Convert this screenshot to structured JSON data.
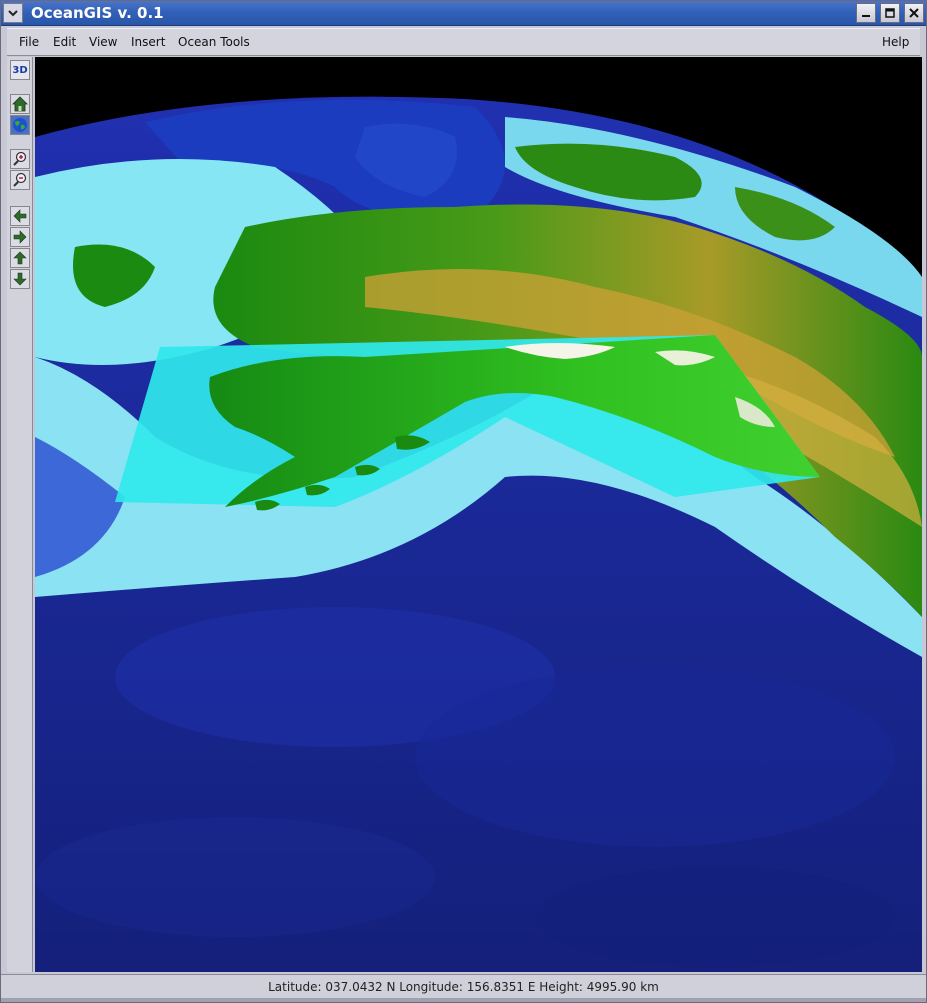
{
  "window": {
    "title": "OceanGIS v. 0.1",
    "menu_button_icon": "chevron-down-icon",
    "minimize_icon": "minimize-icon",
    "maximize_icon": "maximize-icon",
    "close_icon": "close-icon"
  },
  "menubar": {
    "items": [
      "File",
      "Edit",
      "View",
      "Insert",
      "Ocean Tools"
    ],
    "help": "Help"
  },
  "toolbar": {
    "mode_label": "3D",
    "buttons": [
      "home-icon",
      "globe-icon",
      "zoom-in-icon",
      "zoom-out-icon",
      "pan-left-icon",
      "pan-right-icon",
      "pan-up-icon",
      "pan-down-icon"
    ]
  },
  "status": {
    "text": "Latitude: 037.0432 N Longitude: 156.8351 E Height: 4995.90 km"
  },
  "colors": {
    "titlebar": "#3060b8",
    "space": "#000000",
    "ocean_deep": "#1a2a9a",
    "ocean_shallow": "#7ee6f0",
    "land_low": "#1a8a10",
    "land_high": "#c8a030"
  }
}
